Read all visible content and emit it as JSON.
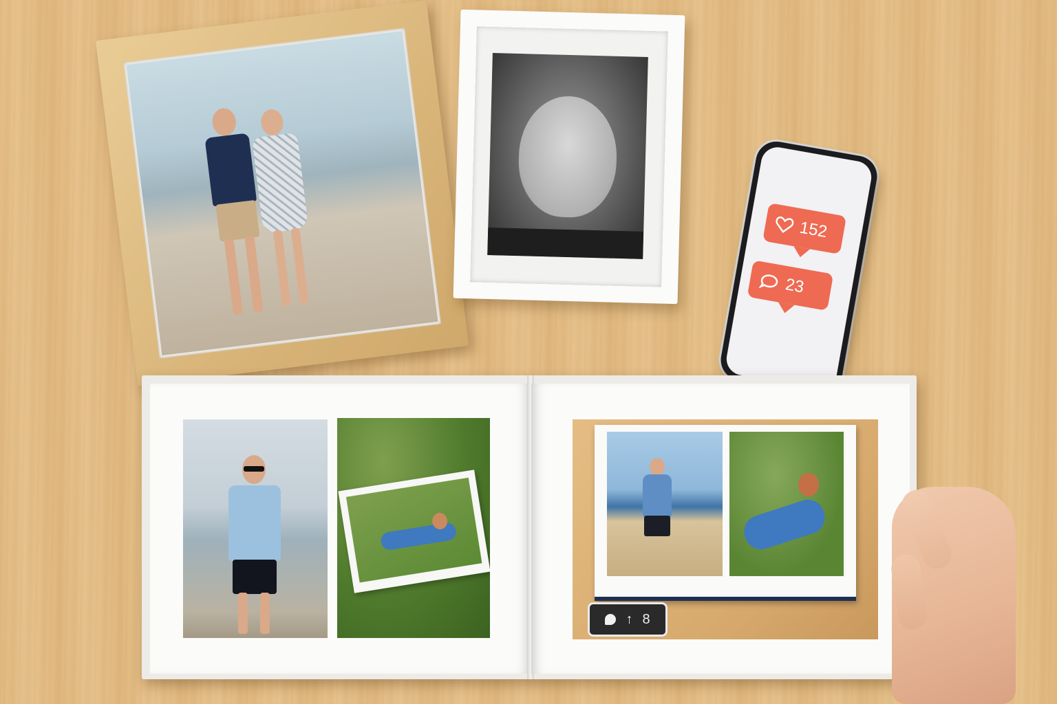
{
  "scene": {
    "description_kind": "photo"
  },
  "phone": {
    "likes_icon": "heart-icon",
    "likes_count": "152",
    "comments_icon": "comment-icon",
    "comments_count": "23",
    "notification_color": "#ee6a52"
  },
  "badge": {
    "icon_one": "comment-icon",
    "icon_two": "arrow-up-icon",
    "count": "8"
  }
}
